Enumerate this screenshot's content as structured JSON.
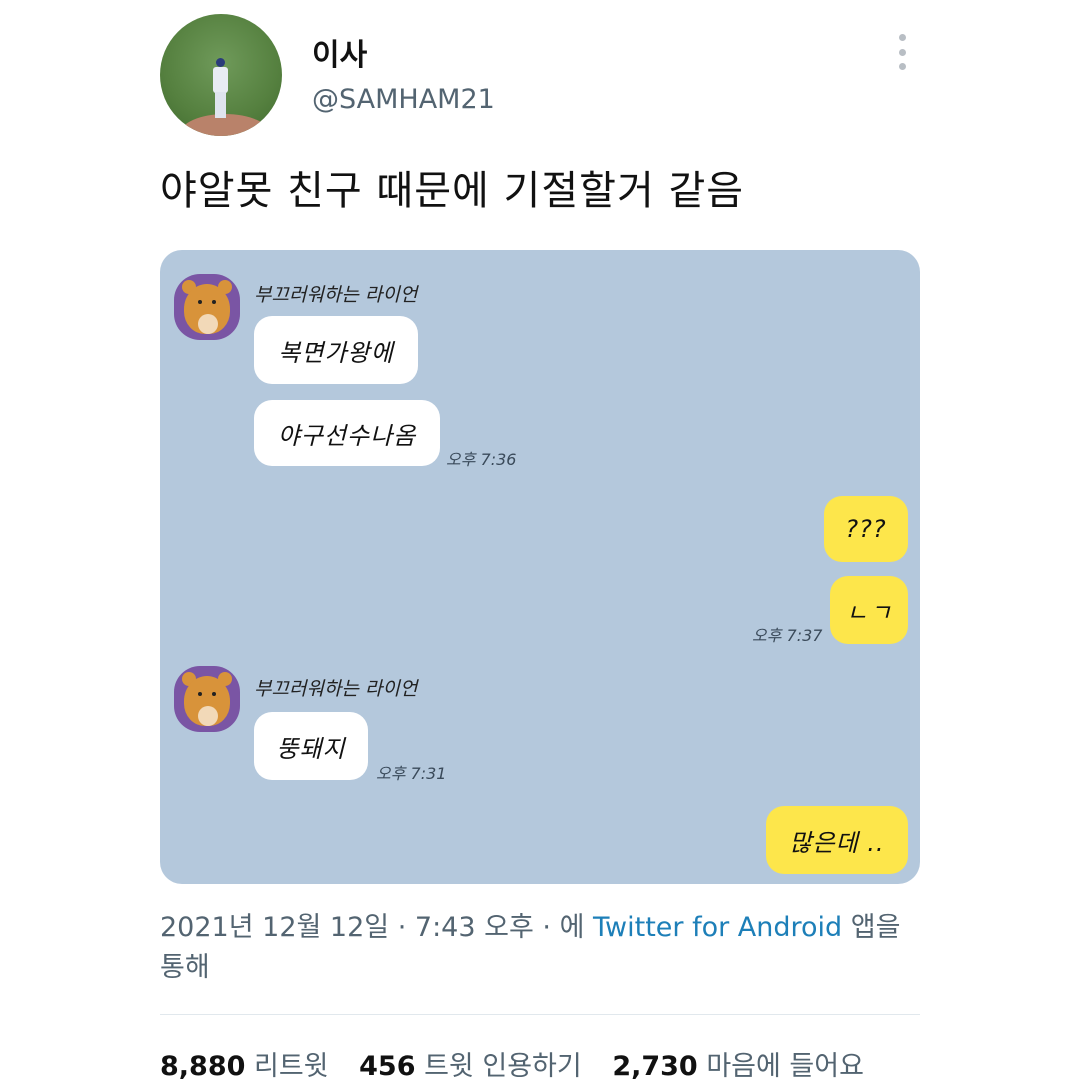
{
  "profile": {
    "display_name": "이사",
    "handle": "@SAMHAM21"
  },
  "tweet": {
    "text": "야알못 친구 때문에 기절할거 같음"
  },
  "chat": {
    "colors": {
      "background": "#b4c8dc",
      "incoming": "#ffffff",
      "outgoing": "#fde64b"
    },
    "messages": [
      {
        "sender": "부끄러워하는 라이언",
        "bubbles": [
          "복면가왕에",
          "야구선수나옴"
        ],
        "time": "오후 7:36"
      },
      {
        "sender": "me",
        "bubbles": [
          "???",
          "ㄴㄱ"
        ],
        "time": "오후 7:37"
      },
      {
        "sender": "부끄러워하는 라이언",
        "bubbles": [
          "뚱돼지"
        ],
        "time": "오후 7:31"
      },
      {
        "sender": "me",
        "bubbles": [
          "많은데 .."
        ]
      }
    ]
  },
  "meta": {
    "date": "2021년 12월 12일",
    "time": "7:43 오후",
    "via_prefix": "에",
    "source": "Twitter for Android",
    "via_suffix": "앱을 통해"
  },
  "stats": {
    "retweets_count": "8,880",
    "retweets_label": "리트윗",
    "quotes_count": "456",
    "quotes_label": "트윗 인용하기",
    "likes_count": "2,730",
    "likes_label": "마음에 들어요"
  }
}
